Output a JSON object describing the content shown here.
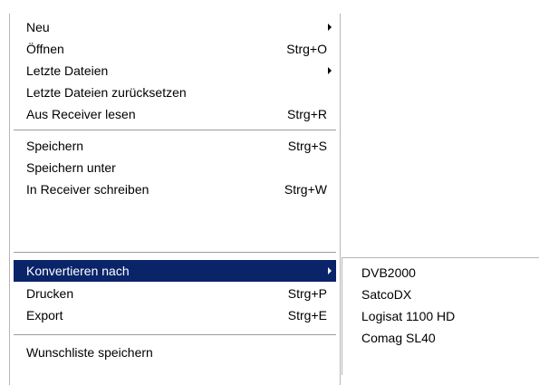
{
  "main_menu": {
    "items": [
      {
        "label": "Neu",
        "shortcut": "",
        "submenu_arrow": "chevron-right-icon"
      },
      {
        "label": "Öffnen",
        "shortcut": "Strg+O"
      },
      {
        "label": "Letzte Dateien",
        "shortcut": "",
        "submenu_arrow": "chevron-right-icon"
      },
      {
        "label": "Letzte Dateien zurücksetzen",
        "shortcut": ""
      },
      {
        "label": "Aus Receiver lesen",
        "shortcut": "Strg+R"
      },
      {
        "label": "Speichern",
        "shortcut": "Strg+S"
      },
      {
        "label": "Speichern unter",
        "shortcut": ""
      },
      {
        "label": "In Receiver schreiben",
        "shortcut": "Strg+W"
      },
      {
        "label": "Konvertieren nach",
        "shortcut": "",
        "submenu_arrow": "chevron-right-icon",
        "highlighted": true
      },
      {
        "label": "Drucken",
        "shortcut": "Strg+P"
      },
      {
        "label": "Export",
        "shortcut": "Strg+E"
      },
      {
        "label": "Wunschliste speichern",
        "shortcut": ""
      }
    ]
  },
  "convert_submenu": {
    "items": [
      {
        "label": "DVB2000"
      },
      {
        "label": "SatcoDX"
      },
      {
        "label": "Logisat 1100 HD"
      },
      {
        "label": "Comag SL40"
      }
    ]
  },
  "colors": {
    "highlight_bg": "#0a246a",
    "highlight_text": "#ffffff",
    "menu_bg": "#ffffff",
    "separator": "#9d9d9d"
  }
}
